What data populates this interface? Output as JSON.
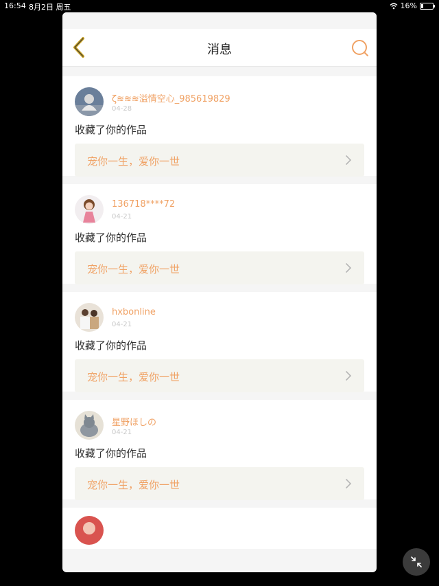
{
  "statusbar": {
    "time": "16:54",
    "date": "8月2日 周五",
    "battery": "16%",
    "battery_level": 0.16
  },
  "navbar": {
    "title": "消息"
  },
  "colors": {
    "accent": "#f0a265",
    "back_icon": "#c8a020",
    "work_bg": "#f4f4ef"
  },
  "notifications": [
    {
      "user": "ζ≋≋≋溢情空心_985619829",
      "date": "04-28",
      "action": "收藏了你的作品",
      "work_title": "宠你一生，爱你一世",
      "avatar": "avatar-1"
    },
    {
      "user": "136718****72",
      "date": "04-21",
      "action": "收藏了你的作品",
      "work_title": "宠你一生，爱你一世",
      "avatar": "avatar-2"
    },
    {
      "user": "hxbonline",
      "date": "04-21",
      "action": "收藏了你的作品",
      "work_title": "宠你一生，爱你一世",
      "avatar": "avatar-3"
    },
    {
      "user": "星野ほしの",
      "date": "04-21",
      "action": "收藏了你的作品",
      "work_title": "宠你一生，爱你一世",
      "avatar": "avatar-4"
    }
  ]
}
